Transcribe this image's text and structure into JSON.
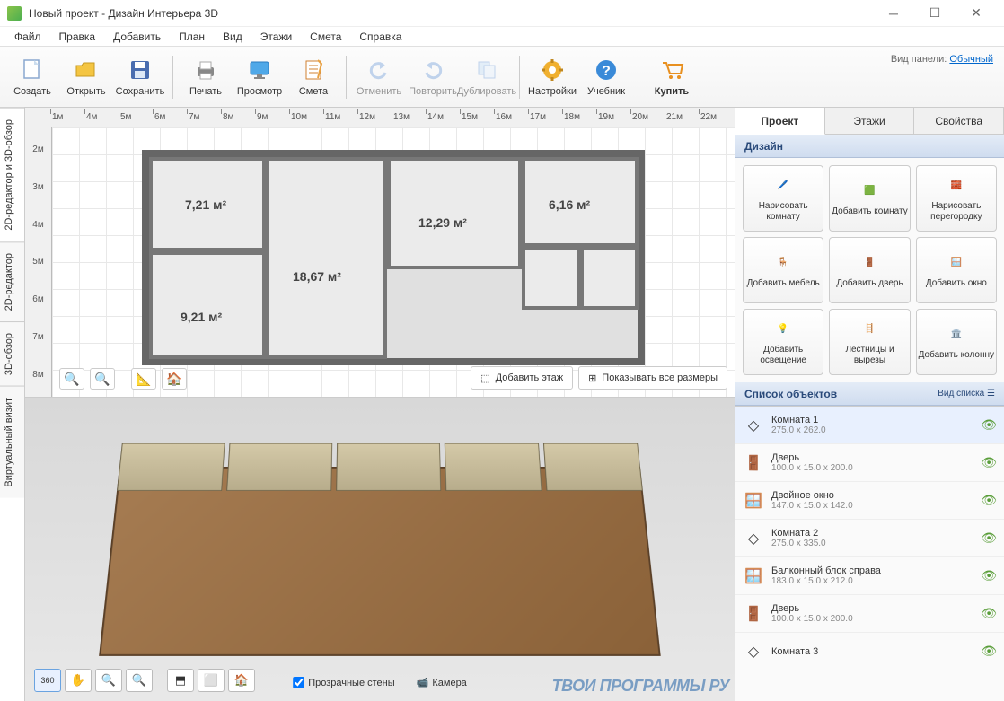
{
  "window": {
    "title": "Новый проект - Дизайн Интерьера 3D"
  },
  "menu": [
    "Файл",
    "Правка",
    "Добавить",
    "План",
    "Вид",
    "Этажи",
    "Смета",
    "Справка"
  ],
  "toolbar": {
    "create": "Создать",
    "open": "Открыть",
    "save": "Сохранить",
    "print": "Печать",
    "preview": "Просмотр",
    "estimate": "Смета",
    "undo": "Отменить",
    "redo": "Повторить",
    "duplicate": "Дублировать",
    "settings": "Настройки",
    "tutorial": "Учебник",
    "buy": "Купить",
    "panelview_label": "Вид панели:",
    "panelview_value": "Обычный"
  },
  "vtabs": {
    "combined": "2D-редактор и 3D-обзор",
    "editor2d": "2D-редактор",
    "view3d": "3D-обзор",
    "virtual": "Виртуальный визит"
  },
  "ruler_h": [
    "1м",
    "4м",
    "5м",
    "6м",
    "7м",
    "8м",
    "9м",
    "10м",
    "11м",
    "12м",
    "13м",
    "14м",
    "15м",
    "16м",
    "17м",
    "18м",
    "19м",
    "20м",
    "21м",
    "22м"
  ],
  "ruler_v": [
    "2м",
    "3м",
    "4м",
    "5м",
    "6м",
    "7м",
    "8м"
  ],
  "room_areas": {
    "r1": "7,21 м²",
    "r2": "18,67 м²",
    "r3": "12,29 м²",
    "r4": "6,16 м²",
    "r5": "9,21 м²"
  },
  "plan_actions": {
    "add_floor": "Добавить этаж",
    "show_dims": "Показывать все размеры"
  },
  "view3d_checks": {
    "transparent": "Прозрачные стены",
    "camera": "Камера"
  },
  "sidebar": {
    "tabs": {
      "project": "Проект",
      "floors": "Этажи",
      "props": "Свойства"
    },
    "design_hdr": "Дизайн",
    "objects_hdr": "Список объектов",
    "list_view": "Вид списка",
    "design_btns": [
      "Нарисовать комнату",
      "Добавить комнату",
      "Нарисовать перегородку",
      "Добавить мебель",
      "Добавить дверь",
      "Добавить окно",
      "Добавить освещение",
      "Лестницы и вырезы",
      "Добавить колонну"
    ],
    "objects": [
      {
        "name": "Комната 1",
        "dims": "275.0 x 262.0",
        "icon": "room"
      },
      {
        "name": "Дверь",
        "dims": "100.0 x 15.0 x 200.0",
        "icon": "door"
      },
      {
        "name": "Двойное окно",
        "dims": "147.0 x 15.0 x 142.0",
        "icon": "window"
      },
      {
        "name": "Комната 2",
        "dims": "275.0 x 335.0",
        "icon": "room"
      },
      {
        "name": "Балконный блок справа",
        "dims": "183.0 x 15.0 x 212.0",
        "icon": "window"
      },
      {
        "name": "Дверь",
        "dims": "100.0 x 15.0 x 200.0",
        "icon": "door"
      },
      {
        "name": "Комната 3",
        "dims": "",
        "icon": "room"
      }
    ]
  },
  "watermark": "ТВОИ ПРОГРАММЫ РУ"
}
